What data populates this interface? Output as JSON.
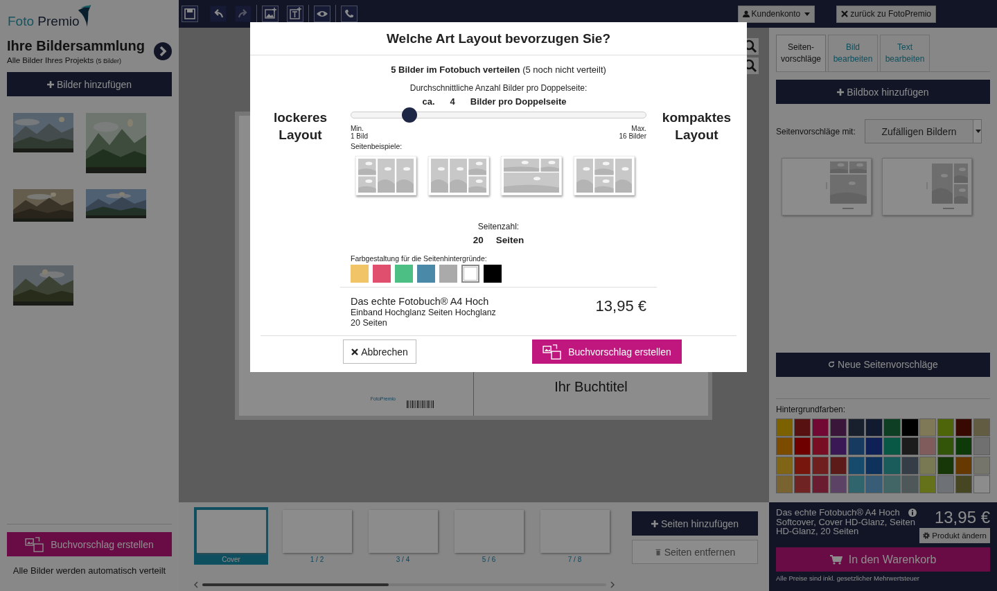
{
  "logo": {
    "first": "Foto",
    "second": "Premio"
  },
  "toolbar": {
    "account_button": "Kundenkonto",
    "back_button": "zurück zu FotoPremio"
  },
  "sidebar": {
    "title": "Ihre Bildersammlung",
    "subtitle": "Alle Bilder Ihres Projekts",
    "count": "(5 Bilder)",
    "add_button": "Bilder hinzufügen",
    "create_button": "Buchvorschlag erstellen",
    "note": "Alle Bilder werden automatisch verteilt"
  },
  "canvas": {
    "logo_text": "FotoPremio",
    "book_title": "Ihr Buchtitel"
  },
  "pages_strip": {
    "pages": [
      {
        "label": "Cover",
        "selected": true
      },
      {
        "label": "1 / 2",
        "selected": false
      },
      {
        "label": "3 / 4",
        "selected": false
      },
      {
        "label": "5 / 6",
        "selected": false
      },
      {
        "label": "7 / 8",
        "selected": false
      }
    ],
    "add_button": "Seiten hinzufügen",
    "remove_button": "Seiten entfernen"
  },
  "right_panel": {
    "tabs": [
      {
        "label": "Seiten-vorschläge",
        "selected": true
      },
      {
        "label": "Bild bearbeiten",
        "selected": false
      },
      {
        "label": "Text bearbeiten",
        "selected": false
      }
    ],
    "add_box_button": "Bildbox hinzufügen",
    "suggestions_label": "Seitenvorschläge mit:",
    "suggestions_select": "Zufälligen Bildern",
    "new_suggestions_button": "Neue Seitenvorschläge",
    "colors_label": "Hintergrundfarben:",
    "colors": [
      {
        "color": "#7b6100"
      },
      {
        "color": "#581111"
      },
      {
        "color": "#720935"
      },
      {
        "color": "#3a173a"
      },
      {
        "color": "#19202d"
      },
      {
        "color": "#111a2f"
      },
      {
        "color": "#0e3e23"
      },
      {
        "color": "#000000"
      },
      {
        "color": "#807958"
      },
      {
        "color": "#4f6509"
      },
      {
        "color": "#370900"
      },
      {
        "color": "#615c42"
      },
      {
        "color": "#7b4c00"
      },
      {
        "color": "#6e0000"
      },
      {
        "color": "#770e23"
      },
      {
        "color": "#3a1755"
      },
      {
        "color": "#173a61"
      },
      {
        "color": "#0e2055"
      },
      {
        "color": "#095846"
      },
      {
        "color": "#1c1c1c"
      },
      {
        "color": "#805c5c"
      },
      {
        "color": "#325509"
      },
      {
        "color": "#0e3a09"
      },
      {
        "color": "#707070"
      },
      {
        "color": "#806516"
      },
      {
        "color": "#77160d"
      },
      {
        "color": "#701f1f"
      },
      {
        "color": "#5c1a19"
      },
      {
        "color": "#174b6e"
      },
      {
        "color": "#0e325c"
      },
      {
        "color": "#1a5c5c"
      },
      {
        "color": "#353e46"
      },
      {
        "color": "#797954"
      },
      {
        "color": "#173709"
      },
      {
        "color": "#653900"
      },
      {
        "color": "#75756c"
      },
      {
        "color": "#796330"
      },
      {
        "color": "#702323"
      },
      {
        "color": "#6a1d30"
      },
      {
        "color": "#5c4265"
      },
      {
        "color": "#30656e"
      },
      {
        "color": "#395c77"
      },
      {
        "color": "#426565"
      },
      {
        "color": "#4f5858"
      },
      {
        "color": "#65721a"
      },
      {
        "color": "#6e7277"
      },
      {
        "color": "#464623"
      },
      {
        "color": "#8c8c8c"
      }
    ]
  },
  "product_bar": {
    "name": "Das echte Fotobuch® A4 Hoch",
    "details": "Softcover, Cover HD-Glanz, Seiten HD-Glanz, 20 Seiten",
    "price": "13,95 €",
    "change_button": "Produkt ändern",
    "cart_button": "In den Warenkorb",
    "tax_note": "Alle Preise sind inkl. gesetzlicher Mehrwertsteuer"
  },
  "dialog": {
    "title": "Welche Art Layout bevorzugen Sie?",
    "summary": "**5 Bilder im Fotobuch verteilen** (5 noch nicht verteilt)",
    "avg_label": "Durchschnittliche Anzahl Bilder pro Doppelseite:",
    "approx": "ca.",
    "value": "4",
    "unit": "Bilder pro Doppelseite",
    "left_label": "lockeres Layout",
    "right_label": "kompaktes Layout",
    "slider": {
      "level": 0.2
    },
    "min_label": "Min.",
    "min_value": "1 Bild",
    "max_label": "Max.",
    "max_value": "16 Bilder",
    "examples_label": "Seitenbeispiele:",
    "pages_label": "Seitenzahl:",
    "pages_value": "20",
    "pages_unit": "Seiten",
    "colors_label": "Farbgestaltung für die Seitenhintergründe:",
    "colors": [
      {
        "color": "#f2c468",
        "selected": false
      },
      {
        "color": "#e0506e",
        "selected": false
      },
      {
        "color": "#4cc084",
        "selected": false
      },
      {
        "color": "#4a8aa8",
        "selected": false
      },
      {
        "color": "#aaaaaa",
        "selected": false
      },
      {
        "color": "#ffffff",
        "selected": true
      },
      {
        "color": "#000000",
        "selected": false
      }
    ],
    "product_name": "Das echte Fotobuch® A4 Hoch",
    "product_binding": "Einband Hochglanz Seiten Hochglanz",
    "product_pages": "20 Seiten",
    "price": "13,95 €",
    "cancel_button": "Abbrechen",
    "create_button": "Buchvorschlag erstellen"
  }
}
